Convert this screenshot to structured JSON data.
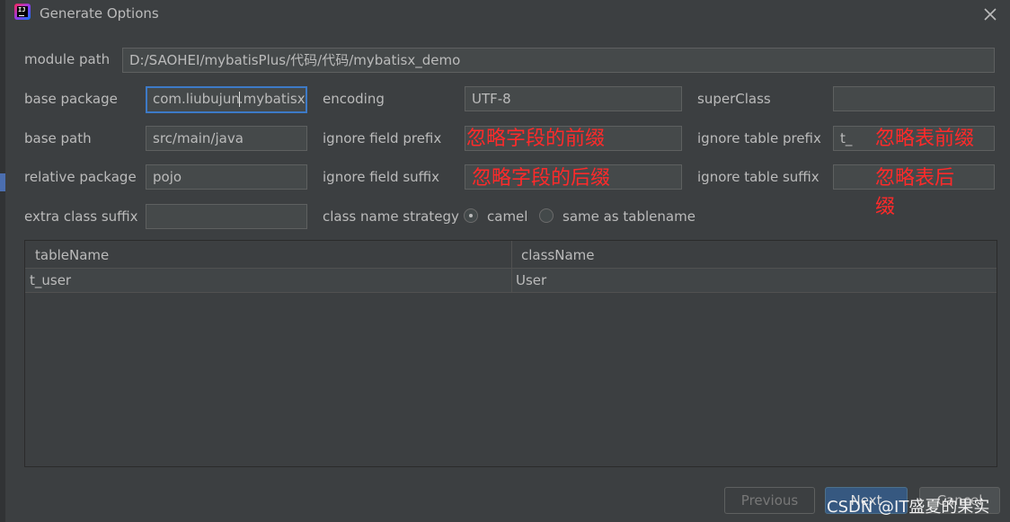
{
  "window": {
    "title": "Generate Options"
  },
  "form": {
    "module_path": {
      "label": "module path",
      "value": "D:/SAOHEI/mybatisPlus/代码/代码/mybatisx_demo"
    },
    "base_package": {
      "label": "base package",
      "value_before_caret": "com.liubujun",
      "value_after_caret": ".mybatisx"
    },
    "encoding": {
      "label": "encoding",
      "value": "UTF-8"
    },
    "super_class": {
      "label": "superClass",
      "value": ""
    },
    "base_path": {
      "label": "base path",
      "value": "src/main/java"
    },
    "ignore_field_prefix": {
      "label": "ignore field prefix",
      "value": ""
    },
    "ignore_table_prefix": {
      "label": "ignore table prefix",
      "value": "t_"
    },
    "relative_package": {
      "label": "relative package",
      "value": "pojo"
    },
    "ignore_field_suffix": {
      "label": "ignore field suffix",
      "value": ""
    },
    "ignore_table_suffix": {
      "label": "ignore table suffix",
      "value": ""
    },
    "extra_class_suffix": {
      "label": "extra class suffix",
      "value": ""
    },
    "class_name_strategy": {
      "label": "class name strategy",
      "options": [
        "camel",
        "same as tablename"
      ],
      "selected": "camel"
    }
  },
  "annotations": {
    "field_prefix": "忽略字段的前缀",
    "field_suffix": "忽略字段的后缀",
    "table_prefix": "忽略表前缀",
    "table_suffix_line1": "忽略表后",
    "table_suffix_line2": "缀",
    "color": "#ff2a2a"
  },
  "table": {
    "columns": [
      "tableName",
      "className"
    ],
    "rows": [
      [
        "t_user",
        "User"
      ]
    ]
  },
  "buttons": {
    "previous": "Previous",
    "next": "Next",
    "cancel": "Cancel"
  },
  "watermark": "CSDN @IT盛夏的果实",
  "colors": {
    "background": "#3c3f41",
    "field": "#45494a",
    "focus_border": "#3d7ac7",
    "text": "#bbbbbb"
  }
}
